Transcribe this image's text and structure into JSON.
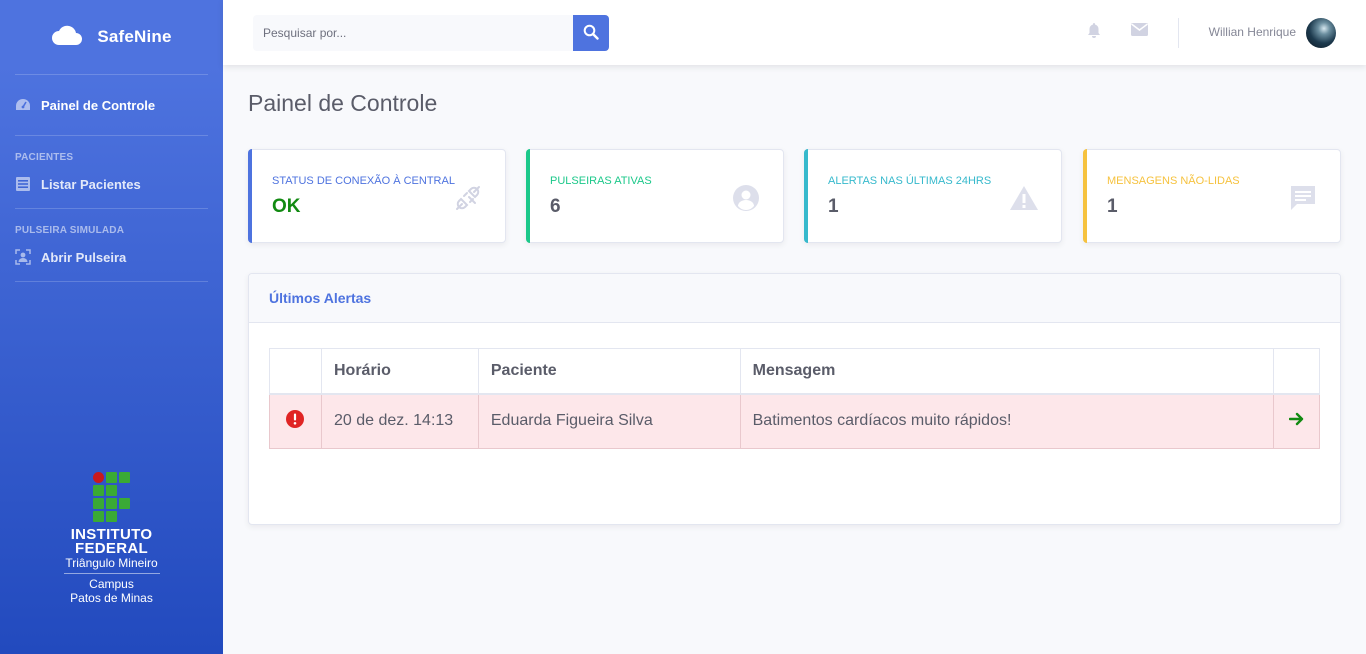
{
  "sidebar": {
    "brand": "SafeNine",
    "dashboard_label": "Painel de Controle",
    "section_patients": "PACIENTES",
    "list_patients_label": "Listar Pacientes",
    "section_bracelet": "PULSEIRA SIMULADA",
    "open_bracelet_label": "Abrir Pulseira",
    "institution": {
      "line1": "INSTITUTO",
      "line2": "FEDERAL",
      "line3": "Triângulo Mineiro",
      "line4": "Campus",
      "line5": "Patos de Minas"
    }
  },
  "topbar": {
    "search_placeholder": "Pesquisar por...",
    "user_name": "Willian Henrique"
  },
  "page": {
    "title": "Painel de Controle"
  },
  "cards": [
    {
      "label": "STATUS DE CONEXÃO À CENTRAL",
      "value": "OK",
      "color": "#4e73df",
      "value_color": "#128a12",
      "icon": "plug-icon"
    },
    {
      "label": "PULSEIRAS ATIVAS",
      "value": "6",
      "color": "#1cc88a",
      "icon": "user-circle-icon"
    },
    {
      "label": "ALERTAS NAS ÚLTIMAS 24HRS",
      "value": "1",
      "color": "#36b9cc",
      "icon": "warning-icon"
    },
    {
      "label": "MENSAGENS NÃO-LIDAS",
      "value": "1",
      "color": "#f6c23e",
      "icon": "message-icon"
    }
  ],
  "alerts_panel": {
    "title": "Últimos Alertas",
    "columns": [
      "",
      "Horário",
      "Paciente",
      "Mensagem",
      ""
    ],
    "rows": [
      {
        "time": "20 de dez. 14:13",
        "patient": "Eduarda Figueira Silva",
        "message": "Batimentos cardíacos muito rápidos!"
      }
    ]
  },
  "colors": {
    "primary": "#4e73df",
    "danger": "#e02424",
    "success_arrow": "#128a12"
  }
}
